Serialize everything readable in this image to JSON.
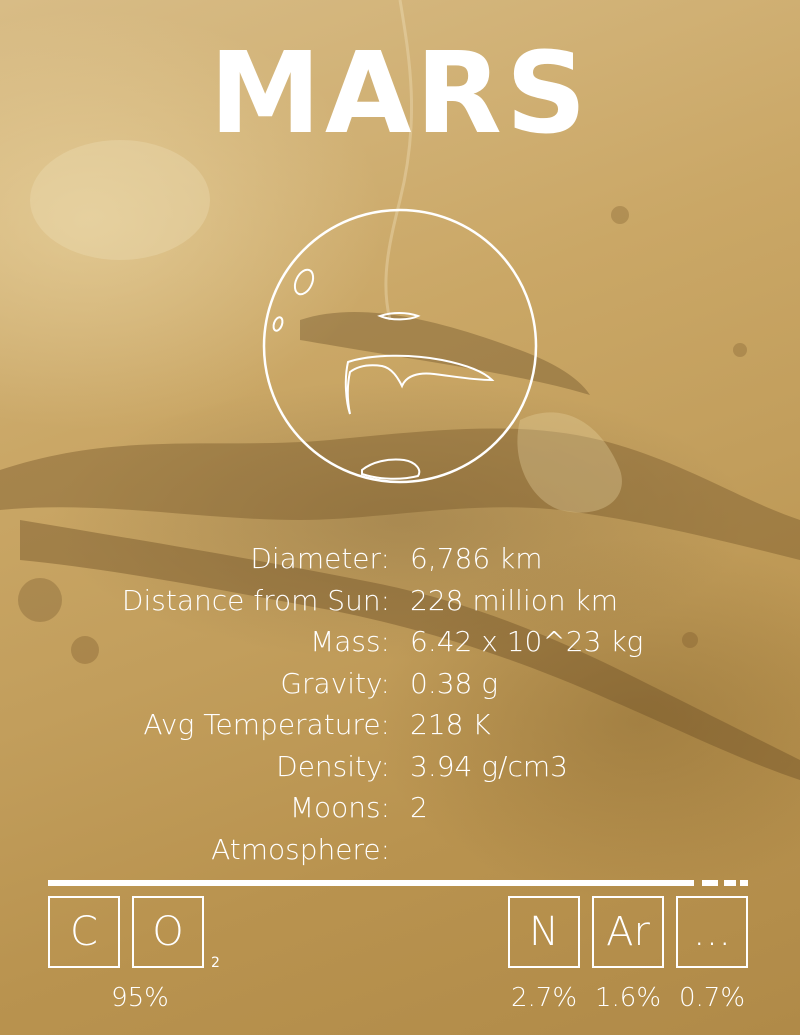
{
  "title": "MARS",
  "facts": [
    {
      "label": "Diameter:",
      "value": "6,786 km"
    },
    {
      "label": "Distance from Sun:",
      "value": "228 million km"
    },
    {
      "label": "Mass:",
      "value": "6.42 x 10^23 kg"
    },
    {
      "label": "Gravity:",
      "value": "0.38 g"
    },
    {
      "label": "Avg Temperature:",
      "value": "218 K"
    },
    {
      "label": "Density:",
      "value": "3.94 g/cm3"
    },
    {
      "label": "Moons:",
      "value": "2"
    },
    {
      "label": "Atmosphere:",
      "value": ""
    }
  ],
  "atmosphere": {
    "co2": {
      "symbols": [
        "C",
        "O"
      ],
      "subscript": "2",
      "percent": "95%"
    },
    "nitrogen": {
      "symbol": "N",
      "percent": "2.7%"
    },
    "argon": {
      "symbol": "Ar",
      "percent": "1.6%"
    },
    "other": {
      "symbol": "...",
      "percent": "0.7%"
    }
  }
}
